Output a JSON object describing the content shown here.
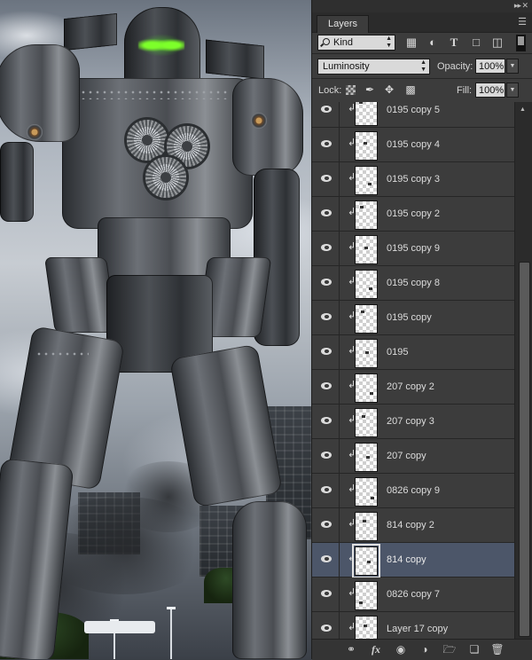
{
  "panel": {
    "tab_label": "Layers",
    "filter": {
      "kind_label": "Kind"
    },
    "blend_mode": "Luminosity",
    "opacity_label": "Opacity:",
    "opacity_value": "100%",
    "lock_label": "Lock:",
    "fill_label": "Fill:",
    "fill_value": "100%",
    "layers": [
      {
        "name": "0195 copy 5",
        "visible": true,
        "clipped": true,
        "selected": false
      },
      {
        "name": "0195 copy 4",
        "visible": true,
        "clipped": true,
        "selected": false
      },
      {
        "name": "0195 copy 3",
        "visible": true,
        "clipped": true,
        "selected": false
      },
      {
        "name": "0195 copy 2",
        "visible": true,
        "clipped": true,
        "selected": false
      },
      {
        "name": "0195 copy 9",
        "visible": true,
        "clipped": true,
        "selected": false
      },
      {
        "name": "0195 copy 8",
        "visible": true,
        "clipped": true,
        "selected": false
      },
      {
        "name": "0195 copy",
        "visible": true,
        "clipped": true,
        "selected": false
      },
      {
        "name": "0195",
        "visible": true,
        "clipped": true,
        "selected": false
      },
      {
        "name": "207 copy 2",
        "visible": true,
        "clipped": true,
        "selected": false
      },
      {
        "name": "207 copy 3",
        "visible": true,
        "clipped": true,
        "selected": false
      },
      {
        "name": "207 copy",
        "visible": true,
        "clipped": true,
        "selected": false
      },
      {
        "name": "0826 copy 9",
        "visible": true,
        "clipped": true,
        "selected": false
      },
      {
        "name": "814 copy 2",
        "visible": true,
        "clipped": true,
        "selected": false
      },
      {
        "name": "814 copy",
        "visible": true,
        "clipped": true,
        "selected": true
      },
      {
        "name": "0826 copy 7",
        "visible": true,
        "clipped": true,
        "selected": false
      },
      {
        "name": "Layer 17 copy",
        "visible": true,
        "clipped": true,
        "selected": false
      }
    ]
  },
  "icons": {
    "filter_row": [
      "image-filter-icon",
      "adjustment-filter-icon",
      "type-filter-icon",
      "shape-filter-icon",
      "smart-object-filter-icon"
    ],
    "lock_row": [
      "lock-transparent-icon",
      "lock-pixels-icon",
      "lock-position-icon",
      "lock-all-icon"
    ],
    "footer": [
      "link-layers-icon",
      "fx-icon",
      "mask-icon",
      "adjustment-layer-icon",
      "group-icon",
      "new-layer-icon",
      "delete-icon"
    ]
  },
  "colors": {
    "panel_bg": "#3c3c3c",
    "selected_row": "#4c5669",
    "eye_glow": "#7dff2a"
  }
}
